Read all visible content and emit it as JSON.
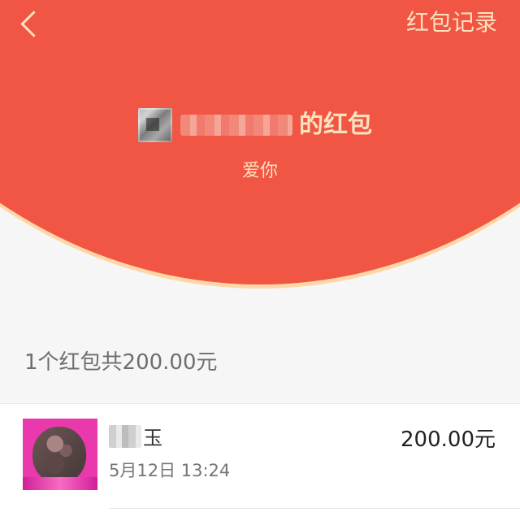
{
  "header": {
    "records_label": "红包记录",
    "sender_title": "的红包",
    "message": "爱你"
  },
  "summary": {
    "text": "1个红包共200.00元"
  },
  "records": [
    {
      "receiver_name_visible": "玉",
      "amount": "200.00元",
      "time": "5月12日  13:24"
    }
  ],
  "icons": {
    "back": "chevron-left-icon"
  },
  "colors": {
    "red_envelope": "#f15543",
    "gold_text": "#fde2bf",
    "avatar_pink": "#ea39ad"
  }
}
